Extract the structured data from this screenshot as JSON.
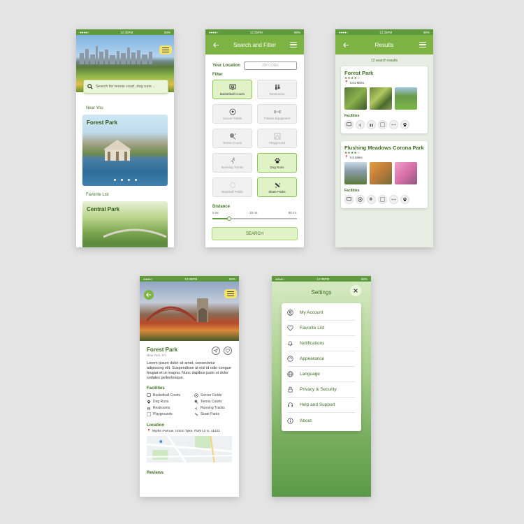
{
  "status": {
    "signal": "●●●●○",
    "time": "12:35PM",
    "battery": "80%"
  },
  "home": {
    "search_placeholder": "Search for tennis court, dog runs ...",
    "near_you_label": "Near You",
    "near_card_title": "Forest Park",
    "favorite_label": "Favorite List",
    "favorite_card_title": "Central Park"
  },
  "filter": {
    "title": "Search and Filter",
    "location_label": "Your Location",
    "zip_placeholder": "ZIP CODE",
    "filter_label": "Filter",
    "options": [
      {
        "label": "Basketball Courts",
        "selected": true,
        "icon": "basketball-icon"
      },
      {
        "label": "Restrooms",
        "selected": false,
        "icon": "restroom-icon"
      },
      {
        "label": "Soccer Fields",
        "selected": false,
        "icon": "soccer-icon"
      },
      {
        "label": "Fitness Equipment",
        "selected": false,
        "icon": "dumbbell-icon"
      },
      {
        "label": "Tennis Courts",
        "selected": false,
        "icon": "tennis-icon"
      },
      {
        "label": "Playground",
        "selected": false,
        "icon": "playground-icon"
      },
      {
        "label": "Running Tracks",
        "selected": false,
        "icon": "running-icon"
      },
      {
        "label": "Dog Runs",
        "selected": true,
        "icon": "paw-icon"
      },
      {
        "label": "Baseball Fields",
        "selected": false,
        "icon": "baseball-icon"
      },
      {
        "label": "Skate Parks",
        "selected": true,
        "icon": "skate-icon"
      }
    ],
    "distance_label": "Distance",
    "distance_ticks": [
      "0 mi.",
      "10 mi.",
      "50 mi."
    ],
    "distance_value_mi": 10,
    "search_button": "SEARCH"
  },
  "results": {
    "title": "Results",
    "count_text": "12 search results",
    "facilities_label": "Facilities",
    "items": [
      {
        "name": "Forest Park",
        "stars": "★★★★☆",
        "distance": "0.01 Miles"
      },
      {
        "name": "Flushing Meadows Corona Park",
        "stars": "★★★★☆",
        "distance": "0.5 Miles"
      }
    ]
  },
  "detail": {
    "name": "Forest Park",
    "location": "New York, NY",
    "description": "Lorem ipsum dolor sit amet, consectetur adipiscing elit. Suspendisse ut nisl id odio congue feugiat et ut magna. Nunc dapibus justo ut dolor sodales pellentesque.",
    "facilities_label": "Facilities",
    "facilities": [
      "Basketball Courts",
      "Soccer Fields",
      "Dog Runs",
      "Tennis Courts",
      "Restrooms",
      "Running Tracks",
      "Playgrounds",
      "Skate Parks"
    ],
    "location_label": "Location",
    "address": "Myrtle Avenue, Union Tpke, Park Ln S, 11421",
    "reviews_label": "Reviews"
  },
  "settings": {
    "title": "Settings",
    "items": [
      {
        "label": "My Account",
        "icon": "user-icon"
      },
      {
        "label": "Favorite List",
        "icon": "heart-icon"
      },
      {
        "label": "Notifications",
        "icon": "bell-icon"
      },
      {
        "label": "Appearance",
        "icon": "palette-icon"
      },
      {
        "label": "Language",
        "icon": "globe-icon"
      },
      {
        "label": "Privacy & Security",
        "icon": "lock-icon"
      },
      {
        "label": "Help and Support",
        "icon": "headset-icon"
      },
      {
        "label": "About",
        "icon": "info-icon"
      }
    ]
  },
  "colors": {
    "primary": "#7cb342",
    "dark_green": "#3f6e21",
    "light_green": "#dff3c6",
    "accent_yellow": "#f3e36b"
  }
}
